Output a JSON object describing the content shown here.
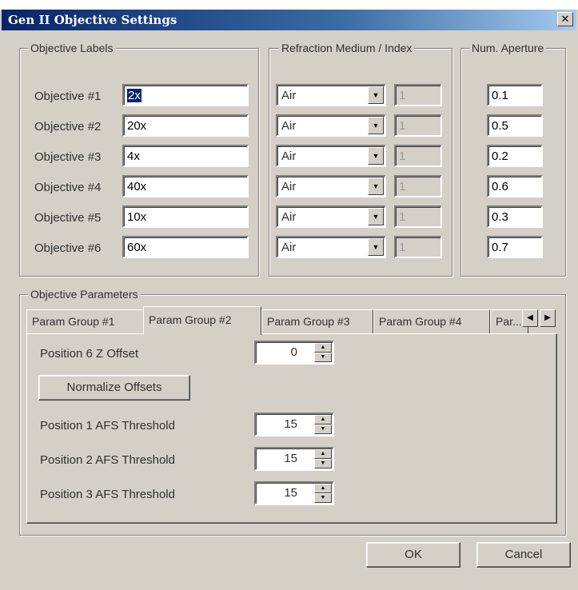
{
  "window": {
    "title": "Gen II Objective Settings",
    "close_glyph": "✕"
  },
  "groups": {
    "labels_title": "Objective Labels",
    "refraction_title": "Refraction Medium / Index",
    "aperture_title": "Num. Aperture",
    "parameters_title": "Objective Parameters"
  },
  "objectives": [
    {
      "name": "Objective #1",
      "label": "2x",
      "medium": "Air",
      "index": "1",
      "aperture": "0.1"
    },
    {
      "name": "Objective #2",
      "label": "20x",
      "medium": "Air",
      "index": "1",
      "aperture": "0.5"
    },
    {
      "name": "Objective #3",
      "label": "4x",
      "medium": "Air",
      "index": "1",
      "aperture": "0.2"
    },
    {
      "name": "Objective #4",
      "label": "40x",
      "medium": "Air",
      "index": "1",
      "aperture": "0.6"
    },
    {
      "name": "Objective #5",
      "label": "10x",
      "medium": "Air",
      "index": "1",
      "aperture": "0.3"
    },
    {
      "name": "Objective #6",
      "label": "60x",
      "medium": "Air",
      "index": "1",
      "aperture": "0.7"
    }
  ],
  "tabs": [
    "Param Group #1",
    "Param Group #2",
    "Param Group #3",
    "Param Group #4",
    "Par..."
  ],
  "active_tab": "Param Group #2",
  "params": {
    "offset_label": "Position 6 Z Offset",
    "offset_value": "0",
    "normalize_button": "Normalize Offsets",
    "thresholds": [
      {
        "label": "Position 1 AFS Threshold",
        "value": "15"
      },
      {
        "label": "Position 2 AFS Threshold",
        "value": "15"
      },
      {
        "label": "Position 3 AFS Threshold",
        "value": "15"
      }
    ]
  },
  "buttons": {
    "ok": "OK",
    "cancel": "Cancel"
  },
  "colors": {
    "face": "#d4d0c8",
    "title_start": "#08246b",
    "title_end": "#a6caf0",
    "selection": "#0a246a"
  }
}
